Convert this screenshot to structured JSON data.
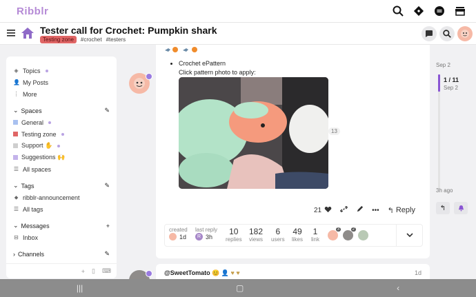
{
  "app": {
    "brand": "Ribblr"
  },
  "topic": {
    "title": "Tester call for Crochet: Pumpkin shark",
    "category": "Testing zone",
    "tags": [
      "#crochet",
      "#testers"
    ]
  },
  "sidebar": {
    "top_items": [
      {
        "label": "Topics",
        "icon": "topics-icon"
      },
      {
        "label": "My Posts",
        "icon": "user-icon"
      },
      {
        "label": "More",
        "icon": "more-icon"
      }
    ],
    "spaces_header": "Spaces",
    "spaces": [
      {
        "label": "General",
        "color": "#a9c1f0"
      },
      {
        "label": "Testing zone",
        "color": "#e06666"
      },
      {
        "label": "Support ✋",
        "color": "#cfcfcf"
      },
      {
        "label": "Suggestions 🙌",
        "color": "#c4b3ea"
      }
    ],
    "all_spaces": "All spaces",
    "tags_header": "Tags",
    "tags": [
      "ribblr-announcement"
    ],
    "all_tags": "All tags",
    "messages_header": "Messages",
    "inbox": "Inbox",
    "channels_header": "Channels"
  },
  "post": {
    "bullet": "Crochet ePattern",
    "apply_text": "Click pattern photo to apply:",
    "image_count": "13",
    "likes": "21",
    "reply_label": "Reply"
  },
  "stats": {
    "created_label": "created",
    "created_value": "1d",
    "last_reply_label": "last reply",
    "last_reply_value": "3h",
    "replies_value": "10",
    "replies_label": "replies",
    "views_value": "182",
    "views_label": "views",
    "users_value": "6",
    "users_label": "users",
    "likes_value": "49",
    "likes_label": "likes",
    "links_value": "1",
    "links_label": "link",
    "participant_counts": [
      "3",
      "2"
    ]
  },
  "next_post": {
    "username": "@SweetTomato",
    "date": "1d"
  },
  "timeline": {
    "start_date": "Sep 2",
    "position": "1 / 11",
    "position_date": "Sep 2",
    "last_activity": "3h ago"
  },
  "colors": {
    "brand": "#b58ad6",
    "accent": "#8a55d3",
    "category": "#e06666"
  }
}
